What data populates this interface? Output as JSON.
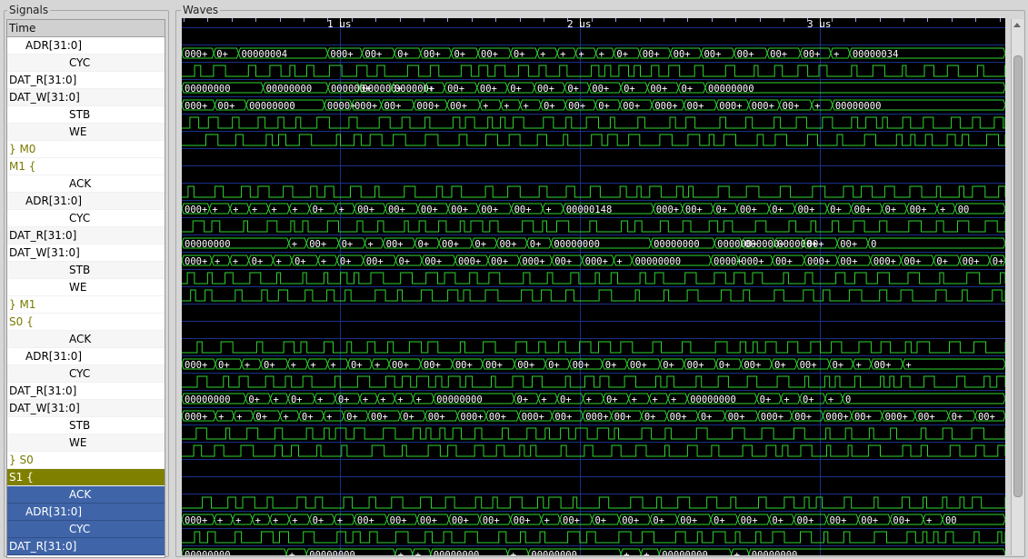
{
  "panels": {
    "signals_label": "Signals",
    "waves_label": "Waves"
  },
  "signals": [
    {
      "label": "Time",
      "kind": "header"
    },
    {
      "label": "ADR[31:0]",
      "kind": "bus",
      "indent": 1
    },
    {
      "label": "CYC",
      "kind": "bit",
      "indent": 2
    },
    {
      "label": "DAT_R[31:0]",
      "kind": "bus",
      "indent": 0
    },
    {
      "label": "DAT_W[31:0]",
      "kind": "bus",
      "indent": 0
    },
    {
      "label": "STB",
      "kind": "bit",
      "indent": 2
    },
    {
      "label": "WE",
      "kind": "bit",
      "indent": 2
    },
    {
      "label": "} M0",
      "kind": "group"
    },
    {
      "label": "M1 {",
      "kind": "group"
    },
    {
      "label": "ACK",
      "kind": "bit",
      "indent": 2
    },
    {
      "label": "ADR[31:0]",
      "kind": "bus",
      "indent": 1
    },
    {
      "label": "CYC",
      "kind": "bit",
      "indent": 2
    },
    {
      "label": "DAT_R[31:0]",
      "kind": "bus",
      "indent": 0
    },
    {
      "label": "DAT_W[31:0]",
      "kind": "bus",
      "indent": 0
    },
    {
      "label": "STB",
      "kind": "bit",
      "indent": 2
    },
    {
      "label": "WE",
      "kind": "bit",
      "indent": 2
    },
    {
      "label": "} M1",
      "kind": "group"
    },
    {
      "label": "S0 {",
      "kind": "group"
    },
    {
      "label": "ACK",
      "kind": "bit",
      "indent": 2
    },
    {
      "label": "ADR[31:0]",
      "kind": "bus",
      "indent": 1
    },
    {
      "label": "CYC",
      "kind": "bit",
      "indent": 2
    },
    {
      "label": "DAT_R[31:0]",
      "kind": "bus",
      "indent": 0
    },
    {
      "label": "DAT_W[31:0]",
      "kind": "bus",
      "indent": 0
    },
    {
      "label": "STB",
      "kind": "bit",
      "indent": 2
    },
    {
      "label": "WE",
      "kind": "bit",
      "indent": 2
    },
    {
      "label": "} S0",
      "kind": "group"
    },
    {
      "label": "S1 {",
      "kind": "group",
      "selected": true
    },
    {
      "label": "ACK",
      "kind": "bit",
      "indent": 2,
      "selected": true
    },
    {
      "label": "ADR[31:0]",
      "kind": "bus",
      "indent": 1,
      "selected": true
    },
    {
      "label": "CYC",
      "kind": "bit",
      "indent": 2,
      "selected": true
    },
    {
      "label": "DAT_R[31:0]",
      "kind": "bus",
      "indent": 0,
      "selected": true
    }
  ],
  "time_ticks": [
    "1 us",
    "2 us",
    "3 us"
  ],
  "wave_text": {
    "row1": [
      "000+",
      "0+",
      "00000004",
      "000+",
      "00+",
      "0+",
      "00+",
      "0+",
      "00+",
      "0+",
      "+",
      "+",
      "+",
      "+",
      "0+",
      "00+",
      "00+",
      "00+",
      "00+",
      "00+",
      "00+",
      "+",
      "00000034"
    ],
    "row3": [
      "00000000",
      "00000000",
      "000000+",
      "000000+",
      "000000+",
      "+",
      "00+",
      "00+",
      "0+",
      "00+",
      "0+",
      "00+",
      "0+",
      "00+",
      "0+",
      "00000000"
    ],
    "row4": [
      "000+",
      "00+",
      "00000000",
      "0000+",
      "000+",
      "00+",
      "000+",
      "00+",
      "+",
      "+",
      "+",
      "0+",
      "00+",
      "0+",
      "00+",
      "000+",
      "00+",
      "000+",
      "000+",
      "00+",
      "+",
      "00000000"
    ],
    "row10": [
      "000+",
      "+",
      "+",
      "+",
      "+",
      "+",
      "0+",
      "+",
      "00+",
      "00+",
      "00+",
      "00+",
      "00+",
      "00+",
      "+",
      "00000148",
      "000+",
      "00+",
      "0+",
      "00+",
      "0+",
      "00+",
      "0+",
      "00+",
      "0+",
      "00+",
      "+",
      "00"
    ],
    "row12": [
      "00000000",
      "+",
      "00+",
      "0+",
      "+",
      "00+",
      "0+",
      "00+",
      "0+",
      "00+",
      "0+",
      "00000000",
      "00000000",
      "000000+",
      "000000+",
      "000000+",
      "00+",
      "00+",
      "0"
    ],
    "row13": [
      "000+",
      "+",
      "+",
      "0+",
      "+",
      "0+",
      "+",
      "0+",
      "00+",
      "0+",
      "00+",
      "000+",
      "00+",
      "000+",
      "00+",
      "000+",
      "+",
      "00000000",
      "0000+",
      "000+",
      "00+",
      "000+",
      "00+",
      "000+",
      "00+",
      "0+",
      "00+",
      "0+",
      "00"
    ],
    "row19": [
      "000+",
      "0+",
      "+",
      "0+",
      "+",
      "+",
      "+",
      "0+",
      "+",
      "00+",
      "00+",
      "00+",
      "00+",
      "00+",
      "0+",
      "00+",
      "0+",
      "00+",
      "0+",
      "00+",
      "0+",
      "00+",
      "0+",
      "00+",
      "0+",
      "+",
      "00+",
      "+"
    ],
    "row21": [
      "00000000",
      "0+",
      "+",
      "0+",
      "+",
      "0+",
      "+",
      "+",
      "+",
      "+",
      "00000000",
      "0+",
      "+",
      "0+",
      "+",
      "0+",
      "+",
      "+",
      "+",
      "00000000",
      "0+",
      "+",
      "0+",
      "+",
      "0"
    ],
    "row22": [
      "000+",
      "+",
      "+",
      "0+",
      "+",
      "0+",
      "+",
      "0+",
      "00+",
      "0+",
      "00+",
      "000+",
      "00+",
      "000+",
      "00+",
      "000+",
      "00+",
      "0+",
      "00+",
      "0+",
      "00+",
      "000+",
      "00+",
      "000+",
      "00+",
      "000+",
      "00+",
      "0+",
      "00+",
      "0+",
      "00"
    ],
    "row28": [
      "000+",
      "+",
      "+",
      "+",
      "+",
      "+",
      "0+",
      "+",
      "00+",
      "00+",
      "00+",
      "00+",
      "00+",
      "00+",
      "+",
      "00+",
      "0+",
      "00+",
      "0+",
      "00+",
      "0+",
      "00+",
      "0+",
      "00+",
      "00+",
      "00+",
      "00+",
      "+",
      "00"
    ],
    "row30": [
      "00000000",
      "+",
      "00000000",
      "+",
      "+",
      "00000000",
      "+",
      "00000000",
      "+",
      "+",
      "00000000",
      "+",
      "00000000"
    ]
  },
  "colors": {
    "wave": "#2fd42f",
    "grid": "#1a2f8a",
    "bg": "#000000",
    "text": "#ffffff"
  }
}
